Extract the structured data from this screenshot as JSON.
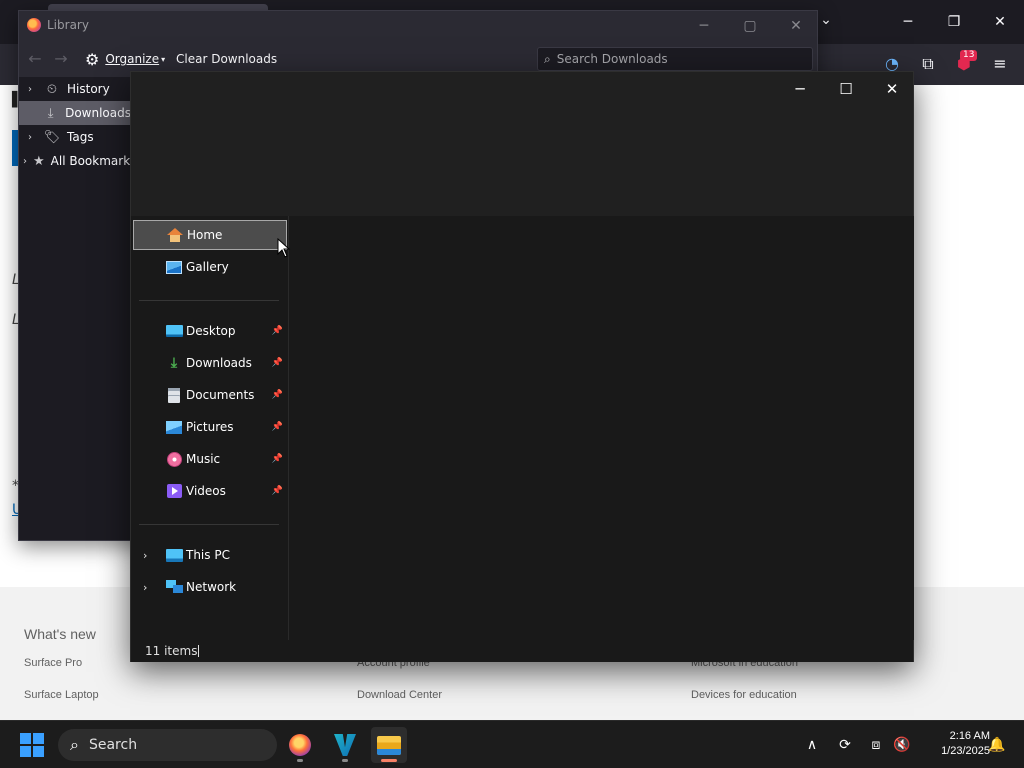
{
  "browser": {
    "tab_list_icon": "chevron-down-icon",
    "window_controls": {
      "minimize": "─",
      "maximize": "❐",
      "close": "✕"
    },
    "toolbar_icons": {
      "sync": "◔",
      "extensions": "⧉",
      "badge_count": "13",
      "menu": "≡"
    },
    "page_fragments": [
      "L",
      "L",
      "L",
      "*",
      "U"
    ],
    "footer": {
      "heading": "What's new",
      "col1": [
        "Surface Pro",
        "Surface Laptop"
      ],
      "col2": [
        "Account profile",
        "Download Center"
      ],
      "col3": [
        "Microsoft in education",
        "Devices for education"
      ]
    }
  },
  "library": {
    "title": "Library",
    "window_controls": {
      "minimize": "─",
      "maximize": "▢",
      "close": "✕"
    },
    "toolbar": {
      "back": "←",
      "forward": "→",
      "organize_label": "Organize",
      "clear_label": "Clear Downloads",
      "search_placeholder": "Search Downloads"
    },
    "tree": [
      {
        "label": "History",
        "twisty": "›",
        "icon": "⏲"
      },
      {
        "label": "Downloads",
        "twisty": "",
        "icon": "⤓"
      },
      {
        "label": "Tags",
        "twisty": "›",
        "icon": "⌂"
      },
      {
        "label": "All Bookmarks",
        "twisty": "›",
        "icon": "★"
      }
    ],
    "selected": "Downloads"
  },
  "explorer": {
    "window_controls": {
      "minimize": "─",
      "maximize": "☐",
      "close": "✕"
    },
    "nav": {
      "top": [
        {
          "label": "Home",
          "icon": "home-icon"
        },
        {
          "label": "Gallery",
          "icon": "gallery-icon"
        }
      ],
      "quick_access": [
        {
          "label": "Desktop",
          "icon": "desktop-icon",
          "pinned": true
        },
        {
          "label": "Downloads",
          "icon": "downloads-icon",
          "pinned": true
        },
        {
          "label": "Documents",
          "icon": "documents-icon",
          "pinned": true
        },
        {
          "label": "Pictures",
          "icon": "pictures-icon",
          "pinned": true
        },
        {
          "label": "Music",
          "icon": "music-icon",
          "pinned": true
        },
        {
          "label": "Videos",
          "icon": "videos-icon",
          "pinned": true
        }
      ],
      "locations": [
        {
          "label": "This PC",
          "icon": "this-pc-icon"
        },
        {
          "label": "Network",
          "icon": "network-icon"
        }
      ],
      "selected": "Home",
      "pin_glyph": "📌",
      "chevron_glyph": "›"
    },
    "status": {
      "item_count": "11 items"
    }
  },
  "taskbar": {
    "search_label": "Search",
    "apps": [
      "Firefox",
      "Visual Studio",
      "File Explorer"
    ],
    "tray": {
      "chevron": "∧",
      "clock_time": "2:16 AM",
      "clock_date": "1/23/2025"
    }
  }
}
